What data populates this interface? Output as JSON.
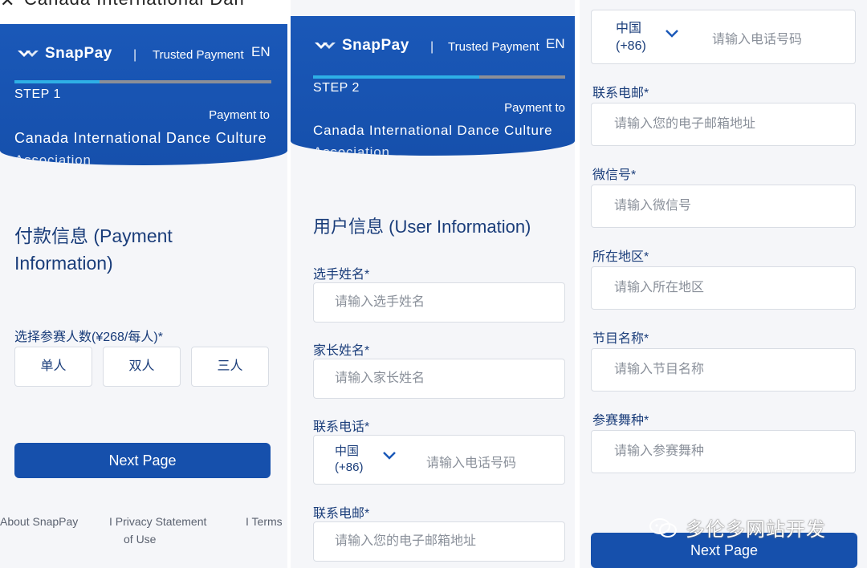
{
  "brand": {
    "name": "SnapPay",
    "divider": "|",
    "tagline": "Trusted Payment",
    "lang": "EN"
  },
  "merchant": {
    "pay_to": "Payment to",
    "name": "Canada International Dance Culture",
    "name_cont": "Association"
  },
  "panel1": {
    "top_title": "Canada International Dan",
    "step_label": "STEP 1",
    "progress": 0.33,
    "section_title_line1": "付款信息 (Payment",
    "section_title_line2": "Information)",
    "count_label": "选择参赛人数(¥268/每人)*",
    "options": [
      "单人",
      "双人",
      "三人"
    ],
    "next": "Next Page",
    "footer": {
      "about": "About SnapPay",
      "privacy": "I Privacy Statement",
      "of_use": "of Use",
      "terms": "I Terms"
    }
  },
  "panel2": {
    "step_label": "STEP 2",
    "progress": 0.66,
    "section_title": "用户信息 (User Information)",
    "fields": [
      {
        "label": "选手姓名*",
        "placeholder": "请输入选手姓名"
      },
      {
        "label": "家长姓名*",
        "placeholder": "请输入家长姓名"
      },
      {
        "label": "联系电话*",
        "country": "中国",
        "code": "(+86)",
        "placeholder": "请输入电话号码"
      },
      {
        "label": "联系电邮*",
        "placeholder": "请输入您的电子邮箱地址"
      }
    ]
  },
  "panel3": {
    "phone": {
      "country": "中国",
      "code": "(+86)",
      "placeholder": "请输入电话号码"
    },
    "fields": [
      {
        "label": "联系电邮*",
        "placeholder": "请输入您的电子邮箱地址"
      },
      {
        "label": "微信号*",
        "placeholder": "请输入微信号"
      },
      {
        "label": "所在地区*",
        "placeholder": "请输入所在地区"
      },
      {
        "label": "节目名称*",
        "placeholder": "请输入节目名称"
      },
      {
        "label": "参赛舞种*",
        "placeholder": "请输入参赛舞种"
      }
    ],
    "next": "Next Page"
  },
  "watermark": "多伦多网站开发"
}
